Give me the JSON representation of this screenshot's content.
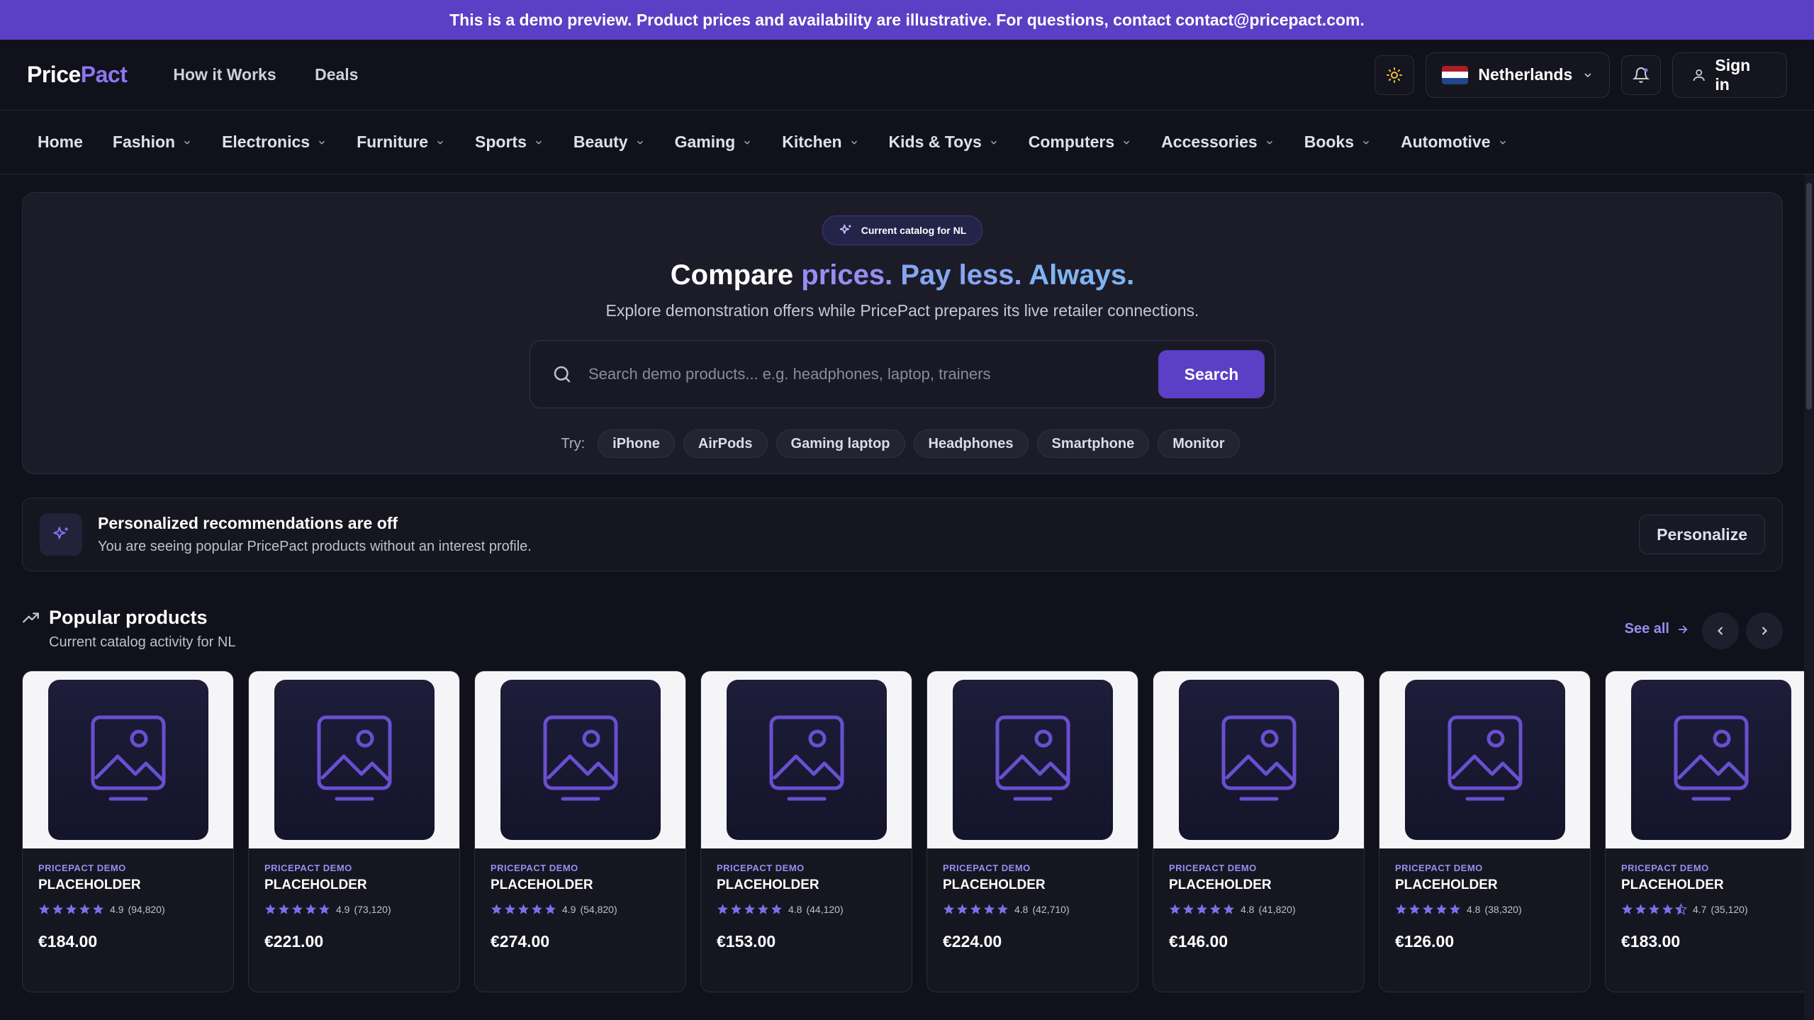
{
  "banner": {
    "text": "This is a demo preview. Product prices and availability are illustrative. For questions, contact contact@pricepact.com."
  },
  "header": {
    "logo_part1": "Price",
    "logo_part2": "Pact",
    "nav": [
      "How it Works",
      "Deals"
    ],
    "country": "Netherlands",
    "sign_in": "Sign in"
  },
  "categories": [
    "Home",
    "Fashion",
    "Electronics",
    "Furniture",
    "Sports",
    "Beauty",
    "Gaming",
    "Kitchen",
    "Kids & Toys",
    "Computers",
    "Accessories",
    "Books",
    "Automotive"
  ],
  "hero": {
    "pill": "Current catalog for NL",
    "title_1": "Compare",
    "title_2": "prices.",
    "title_3": "Pay less.",
    "title_4": "Always.",
    "subtitle": "Explore demonstration offers while PricePact prepares its live retailer connections.",
    "search_placeholder": "Search demo products... e.g. headphones, laptop, trainers",
    "search_button": "Search",
    "try_label": "Try:",
    "try_chips": [
      "iPhone",
      "AirPods",
      "Gaming laptop",
      "Headphones",
      "Smartphone",
      "Monitor"
    ]
  },
  "personalize": {
    "title": "Personalized recommendations are off",
    "desc": "You are seeing popular PricePact products without an interest profile.",
    "button": "Personalize"
  },
  "popular": {
    "title": "Popular products",
    "subtitle": "Current catalog activity for NL",
    "see_all": "See all",
    "products": [
      {
        "brand": "PRICEPACT DEMO",
        "name": "PLACEHOLDER",
        "rating": "4.9",
        "count": "(94,820)",
        "price": "€184.00",
        "stars": 5
      },
      {
        "brand": "PRICEPACT DEMO",
        "name": "PLACEHOLDER",
        "rating": "4.9",
        "count": "(73,120)",
        "price": "€221.00",
        "stars": 5
      },
      {
        "brand": "PRICEPACT DEMO",
        "name": "PLACEHOLDER",
        "rating": "4.9",
        "count": "(54,820)",
        "price": "€274.00",
        "stars": 5
      },
      {
        "brand": "PRICEPACT DEMO",
        "name": "PLACEHOLDER",
        "rating": "4.8",
        "count": "(44,120)",
        "price": "€153.00",
        "stars": 5
      },
      {
        "brand": "PRICEPACT DEMO",
        "name": "PLACEHOLDER",
        "rating": "4.8",
        "count": "(42,710)",
        "price": "€224.00",
        "stars": 5
      },
      {
        "brand": "PRICEPACT DEMO",
        "name": "PLACEHOLDER",
        "rating": "4.8",
        "count": "(41,820)",
        "price": "€146.00",
        "stars": 5
      },
      {
        "brand": "PRICEPACT DEMO",
        "name": "PLACEHOLDER",
        "rating": "4.8",
        "count": "(38,320)",
        "price": "€126.00",
        "stars": 5
      },
      {
        "brand": "PRICEPACT DEMO",
        "name": "PLACEHOLDER",
        "rating": "4.7",
        "count": "(35,120)",
        "price": "€183.00",
        "stars": 4.5
      }
    ]
  },
  "colors": {
    "accent": "#5b3fc4",
    "accent_light": "#9a8cf2",
    "background": "#11111b"
  }
}
